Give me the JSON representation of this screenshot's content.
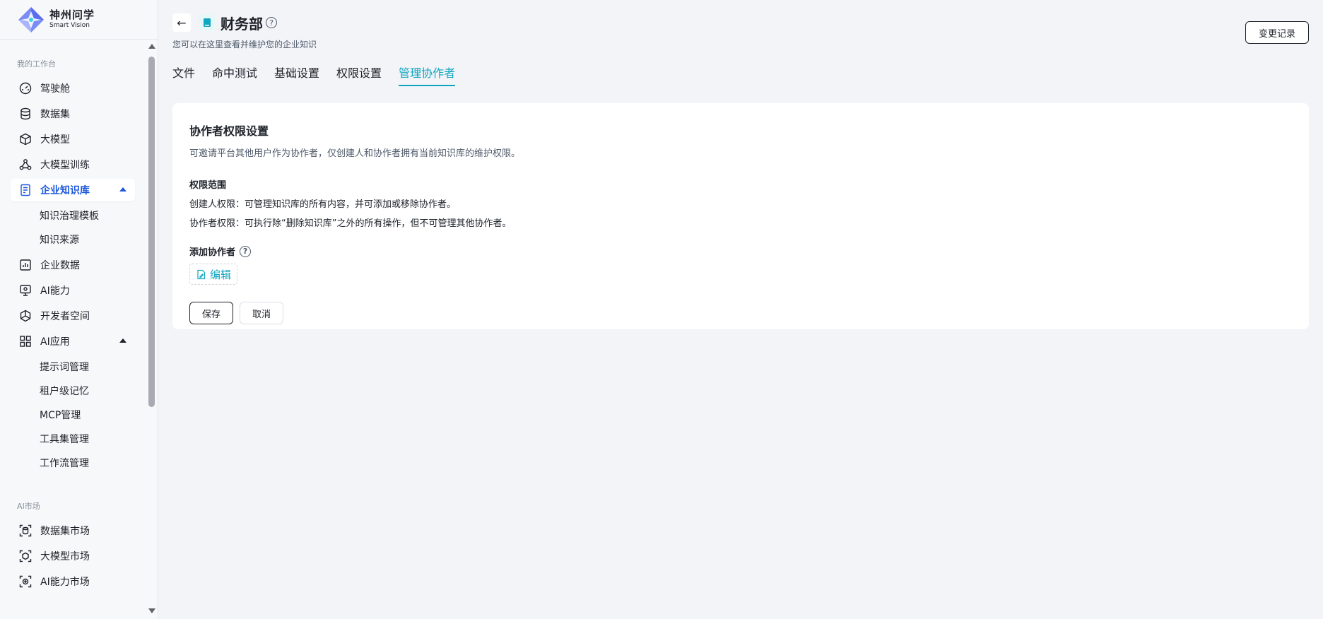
{
  "app": {
    "name_cn": "神州问学",
    "name_en": "Smart Vision"
  },
  "sidebar": {
    "section1_title": "我的工作台",
    "items": [
      {
        "label": "驾驶舱",
        "icon": "gauge-icon"
      },
      {
        "label": "数据集",
        "icon": "database-icon"
      },
      {
        "label": "大模型",
        "icon": "cube-icon"
      },
      {
        "label": "大模型训练",
        "icon": "network-icon"
      },
      {
        "label": "企业知识库",
        "icon": "knowledge-icon",
        "active": true,
        "children": [
          "知识治理模板",
          "知识来源"
        ]
      },
      {
        "label": "企业数据",
        "icon": "chart-icon"
      },
      {
        "label": "AI能力",
        "icon": "monitor-icon"
      },
      {
        "label": "开发者空间",
        "icon": "hexagon-icon"
      },
      {
        "label": "AI应用",
        "icon": "grid-icon",
        "children": [
          "提示词管理",
          "租户级记忆",
          "MCP管理",
          "工具集管理",
          "工作流管理"
        ]
      }
    ],
    "section2_title": "AI市场",
    "market_items": [
      {
        "label": "数据集市场"
      },
      {
        "label": "大模型市场"
      },
      {
        "label": "AI能力市场"
      }
    ]
  },
  "header": {
    "back_symbol": "←",
    "title": "财务部",
    "help_symbol": "?",
    "subtitle": "您可以在这里查看并维护您的企业知识",
    "change_log_label": "变更记录"
  },
  "tabs": [
    {
      "label": "文件"
    },
    {
      "label": "命中测试"
    },
    {
      "label": "基础设置"
    },
    {
      "label": "权限设置"
    },
    {
      "label": "管理协作者",
      "active": true
    }
  ],
  "card": {
    "title": "协作者权限设置",
    "desc": "可邀请平台其他用户作为协作者，仅创建人和协作者拥有当前知识库的维护权限。",
    "scope_title": "权限范围",
    "scope_creator": "创建人权限：可管理知识库的所有内容，并可添加或移除协作者。",
    "scope_collab": "协作者权限：可执行除“删除知识库”之外的所有操作，但不可管理其他协作者。",
    "add_title": "添加协作者",
    "edit_label": "编辑",
    "save_label": "保存",
    "cancel_label": "取消"
  },
  "colors": {
    "accent": "#10a5c0",
    "active_nav": "#1a56db"
  }
}
